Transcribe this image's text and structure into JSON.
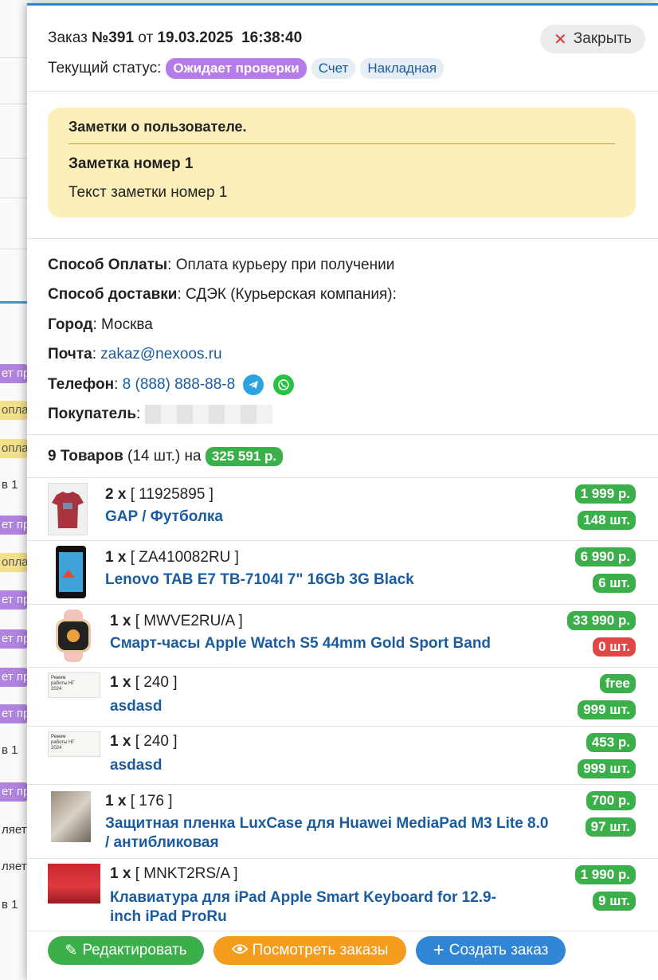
{
  "background_list": {
    "tags": [
      "ет пр",
      "опла",
      "опла",
      "в 1 ",
      "ет пр",
      "опла",
      "ет пр",
      "ет пр",
      "ет пр",
      "ет пр",
      "ет пр",
      "в 1 ",
      "ет пр",
      "ляет",
      "ляет",
      "в 1 "
    ]
  },
  "header": {
    "order_prefix": "Заказ",
    "order_number": "№391",
    "order_date_prefix": "от",
    "order_datetime": "19.03.2025  16:38:40",
    "status_label": "Текущий статус:",
    "status_value": "Ожидает проверки",
    "invoice_link": "Счет",
    "waybill_link": "Накладная",
    "close_label": "Закрыть"
  },
  "notes": {
    "title": "Заметки о пользователе.",
    "items": [
      {
        "name": "Заметка номер 1",
        "text": "Текст заметки номер 1"
      }
    ]
  },
  "info": {
    "payment_label": "Способ Оплаты",
    "payment_value": ": Оплата курьеру при получении",
    "delivery_label": "Способ доставки",
    "delivery_value": ": СДЭК (Курьерская компания):",
    "city_label": "Город",
    "city_value": ": Москва",
    "email_label": "Почта",
    "email_sep": ": ",
    "email_value": "zakaz@nexoos.ru",
    "phone_label": "Телефон",
    "phone_sep": ": ",
    "phone_value": "8 (888) 888-88-8",
    "buyer_label": "Покупатель",
    "buyer_sep": ":"
  },
  "summary": {
    "count_label": "9 Товаров",
    "qty_text": "(14 шт.) на",
    "total": "325 591 р."
  },
  "products": [
    {
      "qty": "2 x",
      "sku": "[ 11925895 ]",
      "name": "GAP / Футболка",
      "price": "1 999 р.",
      "stock": "148 шт.",
      "stock_color": "#3bb04a",
      "icon": "tshirt-image"
    },
    {
      "qty": "1 x",
      "sku": "[ ZA410082RU ]",
      "name": "Lenovo TAB E7 TB-7104I 7\" 16Gb 3G Black",
      "price": "6 990 р.",
      "stock": "6 шт.",
      "stock_color": "#3bb04a",
      "icon": "tablet-image"
    },
    {
      "qty": "1 x",
      "sku": "[ MWVE2RU/A ]",
      "name": "Смарт-часы Apple Watch S5 44mm Gold Sport Band",
      "price": "33 990 р.",
      "stock": "0 шт.",
      "stock_color": "#e04848",
      "icon": "watch-image"
    },
    {
      "qty": "1 x",
      "sku": "[ 240 ]",
      "name": "asdasd",
      "price": "free",
      "stock": "999 шт.",
      "stock_color": "#3bb04a",
      "icon": "banner-image",
      "banner_text": "Режим работы НГ 2024"
    },
    {
      "qty": "1 x",
      "sku": "[ 240 ]",
      "name": "asdasd",
      "price": "453 р.",
      "stock": "999 шт.",
      "stock_color": "#3bb04a",
      "icon": "banner-image",
      "banner_text": "Режим работы НГ 2024"
    },
    {
      "qty": "1 x",
      "sku": "[ 176 ]",
      "name": "Защитная пленка LuxCase для Huawei MediaPad M3 Lite 8.0 / антибликовая",
      "price": "700 р.",
      "stock": "97 шт.",
      "stock_color": "#3bb04a",
      "icon": "film-image"
    },
    {
      "qty": "1 x",
      "sku": "[ MNKT2RS/A ]",
      "name": "Клавиатура для iPad Apple Smart Keyboard for 12.9-inch iPad ProRu",
      "price": "1 990 р.",
      "stock": "9 шт.",
      "stock_color": "#3bb04a",
      "icon": "bedding-image"
    }
  ],
  "footer": {
    "edit_label": "Редактировать",
    "view_orders_label": "Посмотреть заказы",
    "create_order_label": "Создать заказ"
  }
}
